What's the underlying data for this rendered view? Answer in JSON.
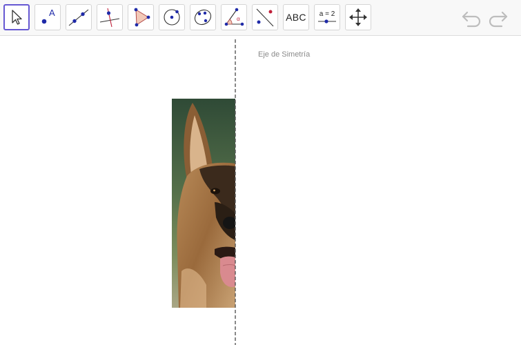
{
  "toolbar": {
    "tools": [
      {
        "name": "move",
        "icon": "arrow-cursor-icon",
        "selected": true
      },
      {
        "name": "point",
        "icon": "point-icon",
        "label": "A"
      },
      {
        "name": "line",
        "icon": "line-through-points-icon"
      },
      {
        "name": "perpendicular-line",
        "icon": "perpendicular-line-icon"
      },
      {
        "name": "polygon",
        "icon": "polygon-icon"
      },
      {
        "name": "circle-center-point",
        "icon": "circle-icon"
      },
      {
        "name": "ellipse",
        "icon": "ellipse-icon"
      },
      {
        "name": "angle",
        "icon": "angle-icon",
        "label": "α"
      },
      {
        "name": "reflect",
        "icon": "reflect-about-line-icon"
      },
      {
        "name": "text",
        "icon": "text-icon",
        "label": "ABC"
      },
      {
        "name": "slider",
        "icon": "slider-icon",
        "label": "a = 2"
      },
      {
        "name": "move-graphics-view",
        "icon": "move-view-icon"
      }
    ],
    "undo_icon": "undo-icon",
    "redo_icon": "redo-icon"
  },
  "canvas": {
    "axis_label": "Eje de Simetría",
    "image_icon": "dog-half-photo"
  },
  "colors": {
    "selected_border": "#6557d2",
    "point_blue": "#1f2aa8",
    "point_red": "#c0203a",
    "axis_dash": "#555555"
  }
}
